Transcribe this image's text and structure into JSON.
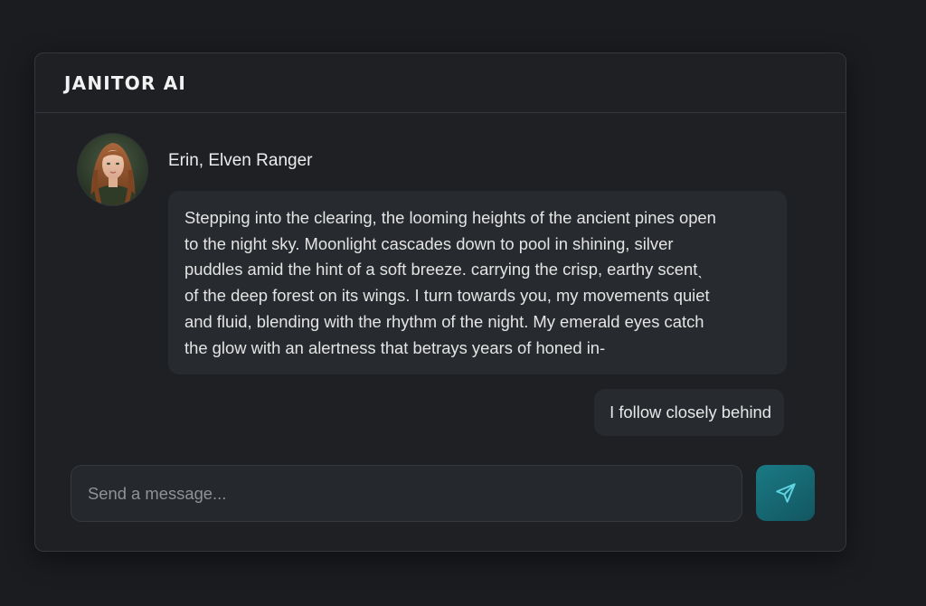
{
  "app": {
    "title": "JANITOR AI"
  },
  "character": {
    "name": "Erin, Elven Ranger",
    "avatar_icon": "avatar-portrait"
  },
  "messages": [
    {
      "sender": "character",
      "lines": [
        "Stepping into the clearing, the looming heights of the ancient pines open",
        "to the night sky. Moonlight cascades down to pool in shining, silver",
        "puddles amid the hint of a soft breeze. carrying the crisp, earthy scentˎ",
        "of the deep forest on its wings. I turn towards you, my movements quiet",
        "and fluid, blending with the rhythm of the night. My emerald eyes catch",
        "the glow with an alertness that betrays years of honed in-"
      ]
    },
    {
      "sender": "user",
      "text": "I follow closely behind"
    }
  ],
  "composer": {
    "placeholder": "Send a message...",
    "send_icon": "send-icon"
  },
  "colors": {
    "background": "#1a1c20",
    "panel": "#1e2024",
    "bubble": "#272a2e",
    "accent": "#1a7a85"
  }
}
